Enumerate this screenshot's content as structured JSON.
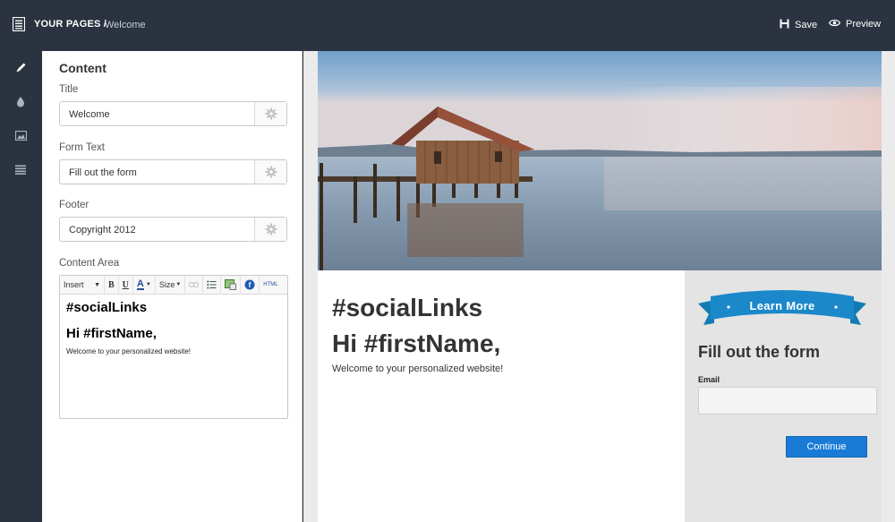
{
  "header": {
    "breadcrumb_root": "YOUR PAGES /",
    "breadcrumb_current": "Welcome",
    "save_label": "Save",
    "preview_label": "Preview"
  },
  "rail": {
    "items": [
      "pencil-icon",
      "droplet-icon",
      "image-icon",
      "list-icon"
    ]
  },
  "panel": {
    "heading": "Content",
    "title_label": "Title",
    "title_value": "Welcome",
    "form_text_label": "Form Text",
    "form_text_value": "Fill out the form",
    "footer_label": "Footer",
    "footer_value": "Copyright 2012",
    "content_area_label": "Content Area",
    "toolbar": {
      "insert": "Insert",
      "bold": "B",
      "underline": "U",
      "font_color": "A",
      "size": "Size",
      "html": "HTML"
    },
    "editor": {
      "line1": "#socialLinks",
      "line2": "Hi #firstName,",
      "line3": "Welcome to your personalized website!"
    }
  },
  "preview": {
    "heading1": "#socialLinks",
    "heading2": "Hi #firstName,",
    "body": "Welcome to your personalized website!",
    "ribbon_text": "Learn More",
    "form_title": "Fill out the form",
    "email_label": "Email",
    "continue_label": "Continue"
  },
  "colors": {
    "chrome": "#2b3340",
    "accent_blue": "#1a7bd6",
    "ribbon_blue": "#1b88c9"
  }
}
